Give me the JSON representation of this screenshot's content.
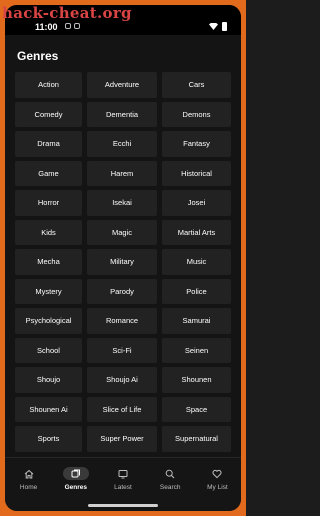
{
  "watermark": "hack-cheat.org",
  "status_bar": {
    "time": "11:00"
  },
  "page": {
    "title": "Genres"
  },
  "genres": [
    "Action",
    "Adventure",
    "Cars",
    "Comedy",
    "Dementia",
    "Demons",
    "Drama",
    "Ecchi",
    "Fantasy",
    "Game",
    "Harem",
    "Historical",
    "Horror",
    "Isekai",
    "Josei",
    "Kids",
    "Magic",
    "Martial Arts",
    "Mecha",
    "Military",
    "Music",
    "Mystery",
    "Parody",
    "Police",
    "Psychological",
    "Romance",
    "Samurai",
    "School",
    "Sci-Fi",
    "Seinen",
    "Shoujo",
    "Shoujo Ai",
    "Shounen",
    "Shounen Ai",
    "Slice of Life",
    "Space",
    "Sports",
    "Super Power",
    "Supernatural"
  ],
  "bottom_nav": {
    "items": [
      {
        "label": "Home",
        "icon": "home-icon"
      },
      {
        "label": "Genres",
        "icon": "genres-icon"
      },
      {
        "label": "Latest",
        "icon": "latest-icon"
      },
      {
        "label": "Search",
        "icon": "search-icon"
      },
      {
        "label": "My List",
        "icon": "heart-icon"
      }
    ],
    "active": "Genres"
  },
  "colors": {
    "frame": "#e26a1c",
    "background": "#141414",
    "button": "#222222",
    "text": "#ffffff",
    "watermark": "#d94444"
  }
}
